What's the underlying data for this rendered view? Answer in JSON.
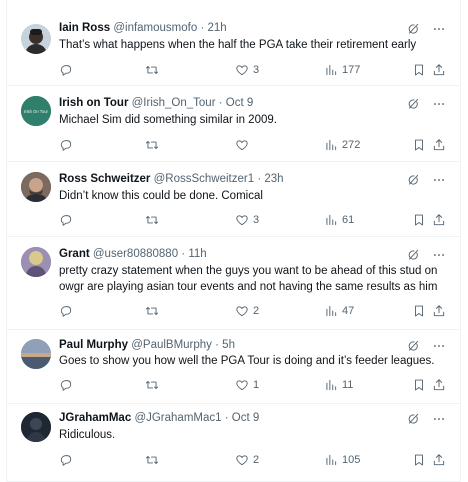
{
  "tweets": [
    {
      "name": "Iain Ross",
      "handle": "@infamousmofo",
      "time": "21h",
      "text": "That’s what happens when the half the PGA take their retirement early",
      "replies": "",
      "retweets": "",
      "likes": "3",
      "views": "177"
    },
    {
      "name": "Irish on Tour",
      "handle": "@Irish_On_Tour",
      "time": "Oct 9",
      "text": "Michael Sim did something similar in 2009.",
      "replies": "",
      "retweets": "",
      "likes": "",
      "views": "272",
      "avatar_text": "Irish On Tour"
    },
    {
      "name": "Ross Schweitzer",
      "handle": "@RossSchweitzer1",
      "time": "23h",
      "text": "Didn’t know this could be done.  Comical",
      "replies": "",
      "retweets": "",
      "likes": "3",
      "views": "61"
    },
    {
      "name": "Grant",
      "handle": "@user80880880",
      "time": "11h",
      "text": "pretty crazy statement when the guys you want to be ahead of this stud on owgr are playing asian tour events and not having the same results as him",
      "replies": "",
      "retweets": "",
      "likes": "2",
      "views": "47"
    },
    {
      "name": "Paul Murphy",
      "handle": "@PaulBMurphy",
      "time": "5h",
      "text": "Goes to show you how well the PGA Tour is doing and it’s feeder leagues.",
      "replies": "",
      "retweets": "",
      "likes": "1",
      "views": "11"
    },
    {
      "name": "JGrahamMac",
      "handle": "@JGrahamMac1",
      "time": "Oct 9",
      "text": "Ridiculous.",
      "replies": "",
      "retweets": "",
      "likes": "2",
      "views": "105"
    }
  ],
  "colors": {
    "text": "#0f1419",
    "muted": "#536471",
    "border": "#eff3f4"
  }
}
